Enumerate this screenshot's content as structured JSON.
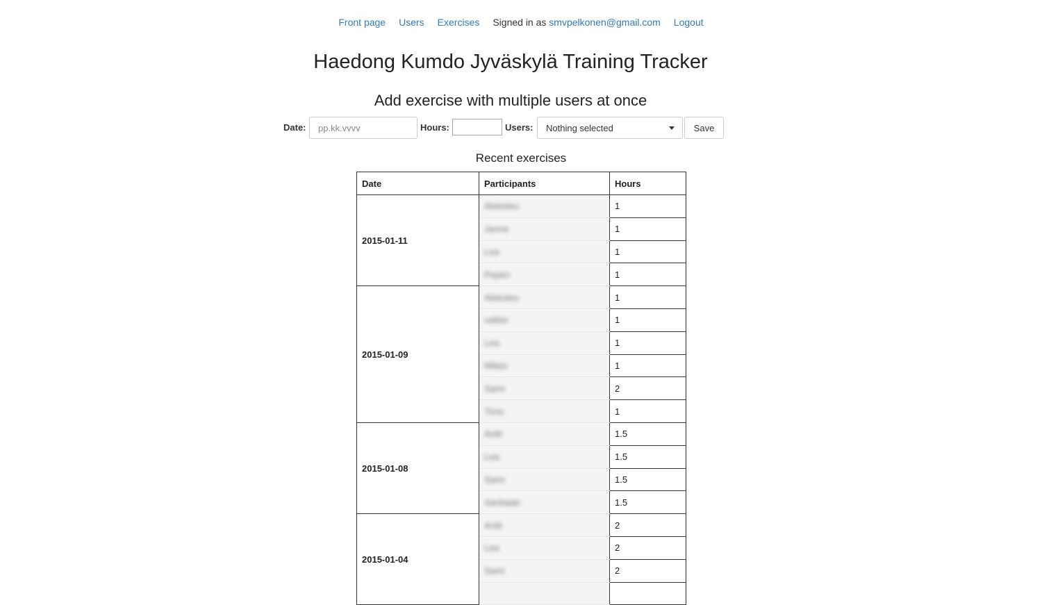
{
  "nav": {
    "front_page": "Front page",
    "users": "Users",
    "exercises": "Exercises",
    "signed_in_as": "Signed in as",
    "email": "smvpelkonen@gmail.com",
    "logout": "Logout"
  },
  "title": "Haedong Kumdo Jyväskylä Training Tracker",
  "form": {
    "heading": "Add exercise with multiple users at once",
    "date_label": "Date:",
    "date_placeholder": "pp.kk.vvvv",
    "hours_label": "Hours:",
    "hours_value": "",
    "users_label": "Users:",
    "users_selected": "Nothing selected",
    "save_label": "Save"
  },
  "recent": {
    "heading": "Recent exercises",
    "columns": [
      "Date",
      "Participants",
      "Hours"
    ],
    "groups": [
      {
        "date": "2015-01-11",
        "rows": [
          {
            "participant": "Aleksteu",
            "hours": "1"
          },
          {
            "participant": "Janne",
            "hours": "1"
          },
          {
            "participant": "Lea",
            "hours": "1"
          },
          {
            "participant": "Pepen",
            "hours": "1"
          }
        ]
      },
      {
        "date": "2015-01-09",
        "rows": [
          {
            "participant": "Aleksteu",
            "hours": "1"
          },
          {
            "participant": "valtter",
            "hours": "1"
          },
          {
            "participant": "Lea",
            "hours": "1"
          },
          {
            "participant": "Mikko",
            "hours": "1"
          },
          {
            "participant": "Sami",
            "hours": "2"
          },
          {
            "participant": "Timo",
            "hours": "1"
          }
        ]
      },
      {
        "date": "2015-01-08",
        "rows": [
          {
            "participant": "Antti",
            "hours": "1.5"
          },
          {
            "participant": "Lea",
            "hours": "1.5"
          },
          {
            "participant": "Sami",
            "hours": "1.5"
          },
          {
            "participant": "Vanilaaki",
            "hours": "1.5"
          }
        ]
      },
      {
        "date": "2015-01-04",
        "rows": [
          {
            "participant": "Antti",
            "hours": "2"
          },
          {
            "participant": "Lea",
            "hours": "2"
          },
          {
            "participant": "Sami",
            "hours": "2"
          },
          {
            "participant": "",
            "hours": ""
          }
        ]
      }
    ]
  }
}
